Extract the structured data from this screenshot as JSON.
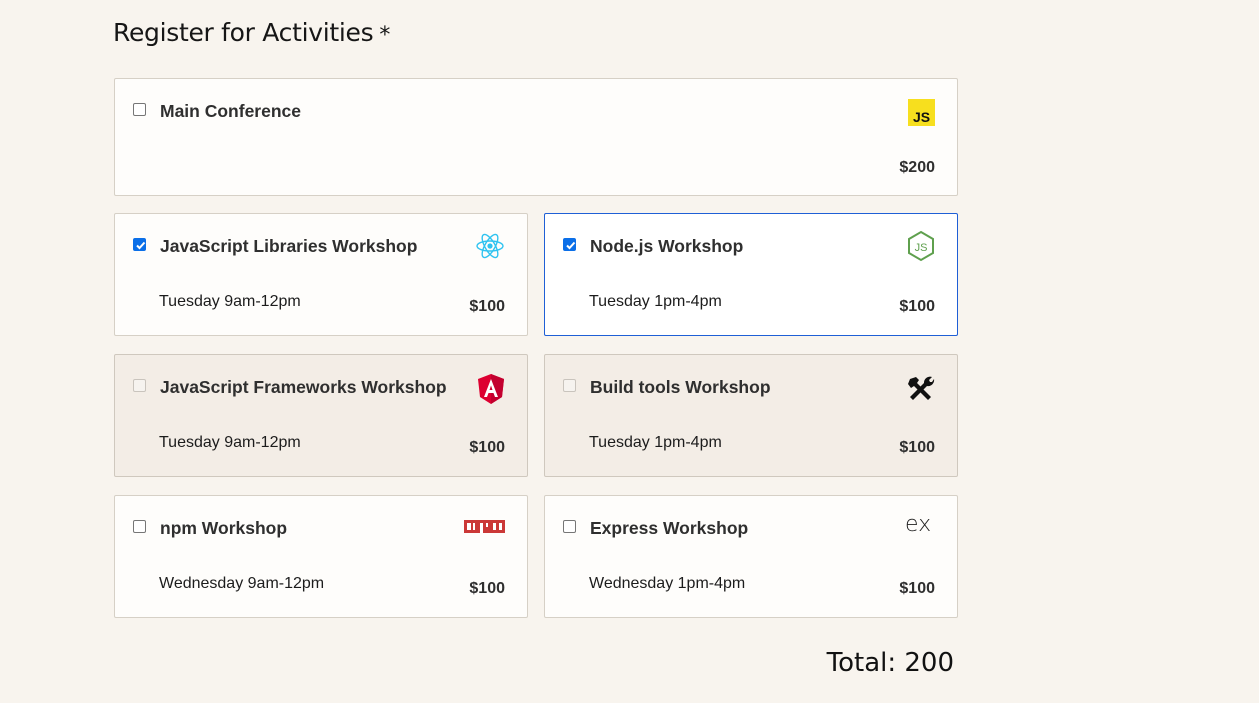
{
  "form": {
    "title": "Register for Activities",
    "required_mark": "*"
  },
  "activities": [
    {
      "name": "Main Conference",
      "time": "",
      "price": "$200",
      "checked": false,
      "disabled": false,
      "icon": "javascript-logo-icon"
    },
    {
      "name": "JavaScript Libraries Workshop",
      "time": "Tuesday 9am-12pm",
      "price": "$100",
      "checked": true,
      "disabled": false,
      "icon": "react-logo-icon"
    },
    {
      "name": "Node.js Workshop",
      "time": "Tuesday 1pm-4pm",
      "price": "$100",
      "checked": true,
      "disabled": false,
      "icon": "nodejs-logo-icon"
    },
    {
      "name": "JavaScript Frameworks Workshop",
      "time": "Tuesday 9am-12pm",
      "price": "$100",
      "checked": false,
      "disabled": true,
      "icon": "angular-logo-icon"
    },
    {
      "name": "Build tools Workshop",
      "time": "Tuesday 1pm-4pm",
      "price": "$100",
      "checked": false,
      "disabled": true,
      "icon": "hammer-wrench-icon"
    },
    {
      "name": "npm Workshop",
      "time": "Wednesday 9am-12pm",
      "price": "$100",
      "checked": false,
      "disabled": false,
      "icon": "npm-logo-icon"
    },
    {
      "name": "Express Workshop",
      "time": "Wednesday 1pm-4pm",
      "price": "$100",
      "checked": false,
      "disabled": false,
      "icon": "express-logo-icon"
    }
  ],
  "total": {
    "label": "Total: 200"
  },
  "colors": {
    "background": "#f8f4ee",
    "selected_border": "#1f5fd6",
    "checkbox_checked": "#0b6fe8",
    "disabled_card": "#f3ede6"
  }
}
